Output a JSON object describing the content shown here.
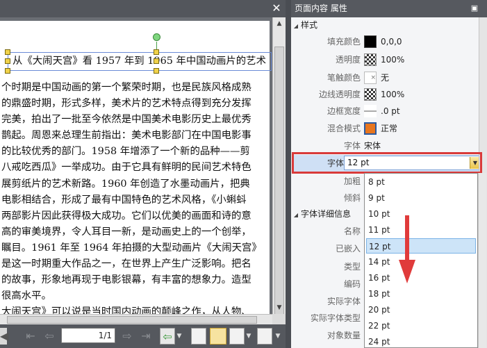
{
  "document": {
    "title_line": "从《大闹天宫》看 1957 年到 1965 年中国动画片的艺术",
    "lines": [
      "个时期是中国动画的第一个繁荣时期，也是民族风格成熟",
      "的鼎盛时期，形式多样，美术片的艺术特点得到充分发挥",
      "完美，拍出了一批至今依然是中国美术电影历史上最优秀",
      "鹊起。周恩来总理生前指出：美术电影部门在中国电影事",
      "的比较优秀的部门。1958 年增添了一个新的品种——剪",
      "八戒吃西瓜》一举成功。由于它具有鲜明的民间艺术特色",
      "展剪纸片的艺术新路。1960 年创造了水墨动画片，把典",
      "电影相结合，形成了最有中国特色的艺术风格，《小蝌蚪",
      "两部影片因此获得极大成功。它们以优美的画面和诗的意",
      "高的审美境界，令人耳目一新，是动画史上的一个创举，",
      "瞩目。1961 年至 1964 年拍摄的大型动画片《大闹天宫》",
      "是这一时期重大作品之一，在世界上产生广泛影响。把名",
      "的故事，形象地再现于电影银幕，有丰富的想象力。造型",
      "很高水平。",
      "大闹天宫》可以说是当时国内动画的颠峰之作，从人物、"
    ],
    "close_icon": "✕"
  },
  "statusbar": {
    "page_indicator": "1/1"
  },
  "panel": {
    "title": "页面内容 属性",
    "style_section": "样式",
    "rows": {
      "fill_color": {
        "label": "填充颜色",
        "value": "0,0,0",
        "color": "#000000"
      },
      "opacity": {
        "label": "透明度",
        "value": "100%"
      },
      "stroke_color": {
        "label": "笔触颜色",
        "value": "无"
      },
      "border_opacity": {
        "label": "边线透明度",
        "value": "100%"
      },
      "border_width": {
        "label": "边框宽度",
        "value": ".0 pt"
      },
      "blend_mode": {
        "label": "混合模式",
        "value": "正常",
        "color": "#e8761e"
      },
      "font": {
        "label": "字体",
        "value": "宋体"
      },
      "font_size": {
        "label": "字体大小",
        "value": "12 pt"
      },
      "bold": {
        "label": "加粗"
      },
      "italic": {
        "label": "倾斜"
      }
    },
    "font_detail_section": "字体详细信息",
    "detail_rows": {
      "name": {
        "label": "名称"
      },
      "embedded": {
        "label": "已嵌入"
      },
      "type": {
        "label": "类型"
      },
      "encoding": {
        "label": "编码"
      },
      "actual_font": {
        "label": "实际字体"
      },
      "actual_font_type": {
        "label": "实际字体类型"
      },
      "object_count": {
        "label": "对象数量"
      }
    }
  },
  "dropdown": {
    "options": [
      "8 pt",
      "9 pt",
      "10 pt",
      "11 pt",
      "12 pt",
      "14 pt",
      "16 pt",
      "18 pt",
      "20 pt",
      "22 pt",
      "24 pt"
    ],
    "selected": "12 pt"
  },
  "colors": {
    "highlight_red": "#d93a3a",
    "selection_blue": "#cde4f8"
  }
}
